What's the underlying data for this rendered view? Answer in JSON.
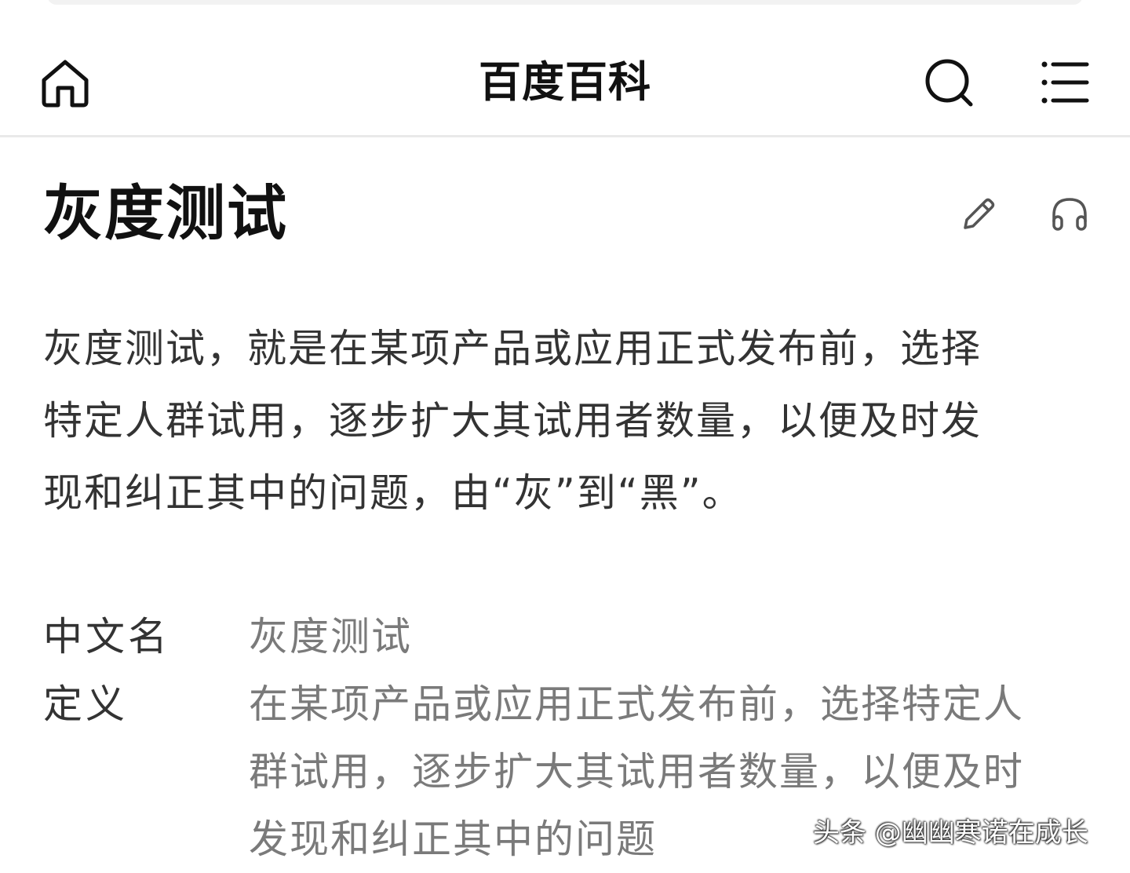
{
  "navbar": {
    "title": "百度百科",
    "home_icon": "home-icon",
    "search_icon": "search-icon",
    "menu_icon": "menu-icon"
  },
  "entry": {
    "title": "灰度测试",
    "edit_icon": "pencil-icon",
    "listen_icon": "headphones-icon",
    "summary_lines": [
      "灰度测试，就是在某项产品或应用正式发布前，选择",
      "特定人群试用，逐步扩大其试用者数量，以便及时发",
      "现和纠正其中的问题，由“灰”到“黑”。"
    ]
  },
  "basic_info": [
    {
      "label": "中文名",
      "value_lines": [
        "灰度测试"
      ]
    },
    {
      "label": "定义",
      "value_lines": [
        "在某项产品或应用正式发布前，选择特定人",
        "群试用，逐步扩大其试用者数量，以便及时",
        "发现和纠正其中的问题"
      ]
    }
  ],
  "watermark": "头条 @幽幽寒诺在成长",
  "colors": {
    "title_text": "#111111",
    "body_text": "#333333",
    "value_text": "#7a7a7a",
    "divider": "#e9e9e9"
  }
}
